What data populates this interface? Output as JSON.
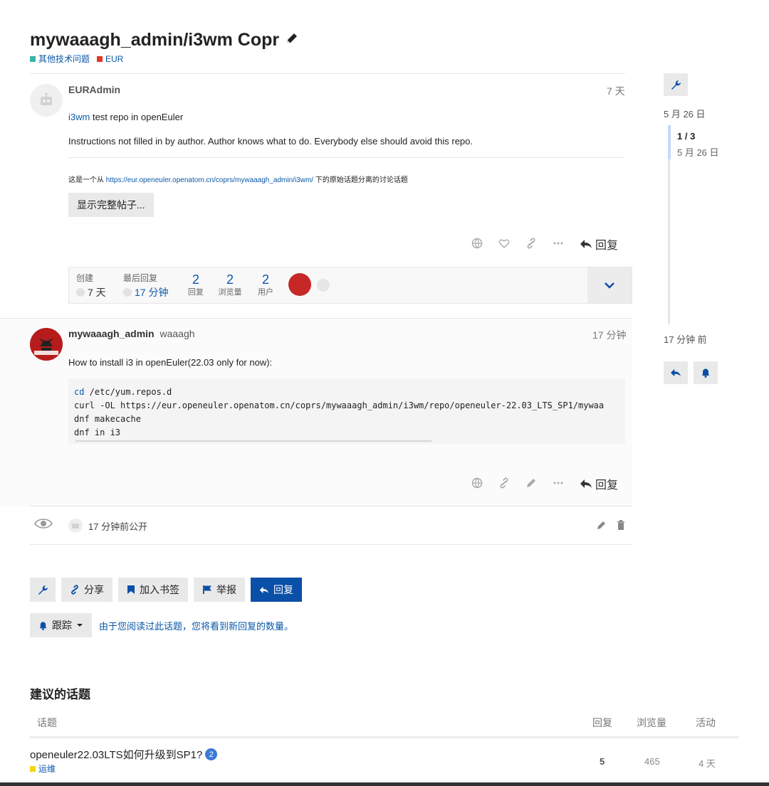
{
  "topic": {
    "title": "mywaaagh_admin/i3wm Copr",
    "categories": [
      {
        "name": "其他技术问题",
        "color": "#3ab5a8"
      },
      {
        "name": "EUR",
        "color": "#e0362c"
      }
    ]
  },
  "post1": {
    "username": "EURAdmin",
    "time": "7 天",
    "line1_link": "i3wm",
    "line1_rest": " test repo in openEuler",
    "line2": "Instructions not filled in by author. Author knows what to do. Everybody else should avoid this repo.",
    "split_prefix": "这是一个从 ",
    "split_link": "https://eur.openeuler.openatom.cn/coprs/mywaaagh_admin/i3wm/",
    "split_suffix": " 下的原始话题分离的讨论话题",
    "show_full": "显示完整帖子...",
    "reply_label": "回复"
  },
  "topic_map": {
    "created_label": "创建",
    "created_value": "7 天",
    "last_reply_label": "最后回复",
    "last_reply_value": "17 分钟",
    "replies": {
      "value": "2",
      "label": "回复"
    },
    "views": {
      "value": "2",
      "label": "浏览量"
    },
    "users": {
      "value": "2",
      "label": "用户"
    }
  },
  "post2": {
    "username": "mywaaagh_admin",
    "user_title": "waaagh",
    "time": "17 分钟",
    "text": "How to install i3 in openEuler(22.03 only for now):",
    "code": [
      {
        "a": "cd",
        "b": " /etc/yum.repos.d"
      },
      {
        "a": "",
        "b": "curl -OL https://eur.openeuler.openatom.cn/coprs/mywaaagh_admin/i3wm/repo/openeuler-22.03_LTS_SP1/mywaa"
      },
      {
        "a": "",
        "b": "dnf makecache"
      },
      {
        "a": "",
        "b": "dnf in i3"
      }
    ],
    "reply_label": "回复"
  },
  "small_action": {
    "text": "17 分钟前公开"
  },
  "timeline": {
    "top_date": "5 月 26 日",
    "position": "1 / 3",
    "position_date": "5 月 26 日",
    "bottom_label": "17 分钟 前"
  },
  "footer_controls": {
    "share": "分享",
    "bookmark": "加入书签",
    "flag": "举报",
    "reply": "回复",
    "tracking": "跟踪",
    "tracking_reason": "由于您阅读过此话题，您将看到新回复的数量。"
  },
  "suggested": {
    "heading": "建议的话题",
    "col_topic": "话题",
    "col_replies": "回复",
    "col_views": "浏览量",
    "col_activity": "活动",
    "rows": [
      {
        "title": "openeuler22.03LTS如何升级到SP1?",
        "badge": "2",
        "category": "运维",
        "category_color": "#f5d515",
        "replies": "5",
        "views": "465",
        "activity": "4 天"
      }
    ]
  },
  "colors": {
    "link": "#0a58a8",
    "primary_button": "#0a4fa8",
    "danger": "#c62828"
  }
}
